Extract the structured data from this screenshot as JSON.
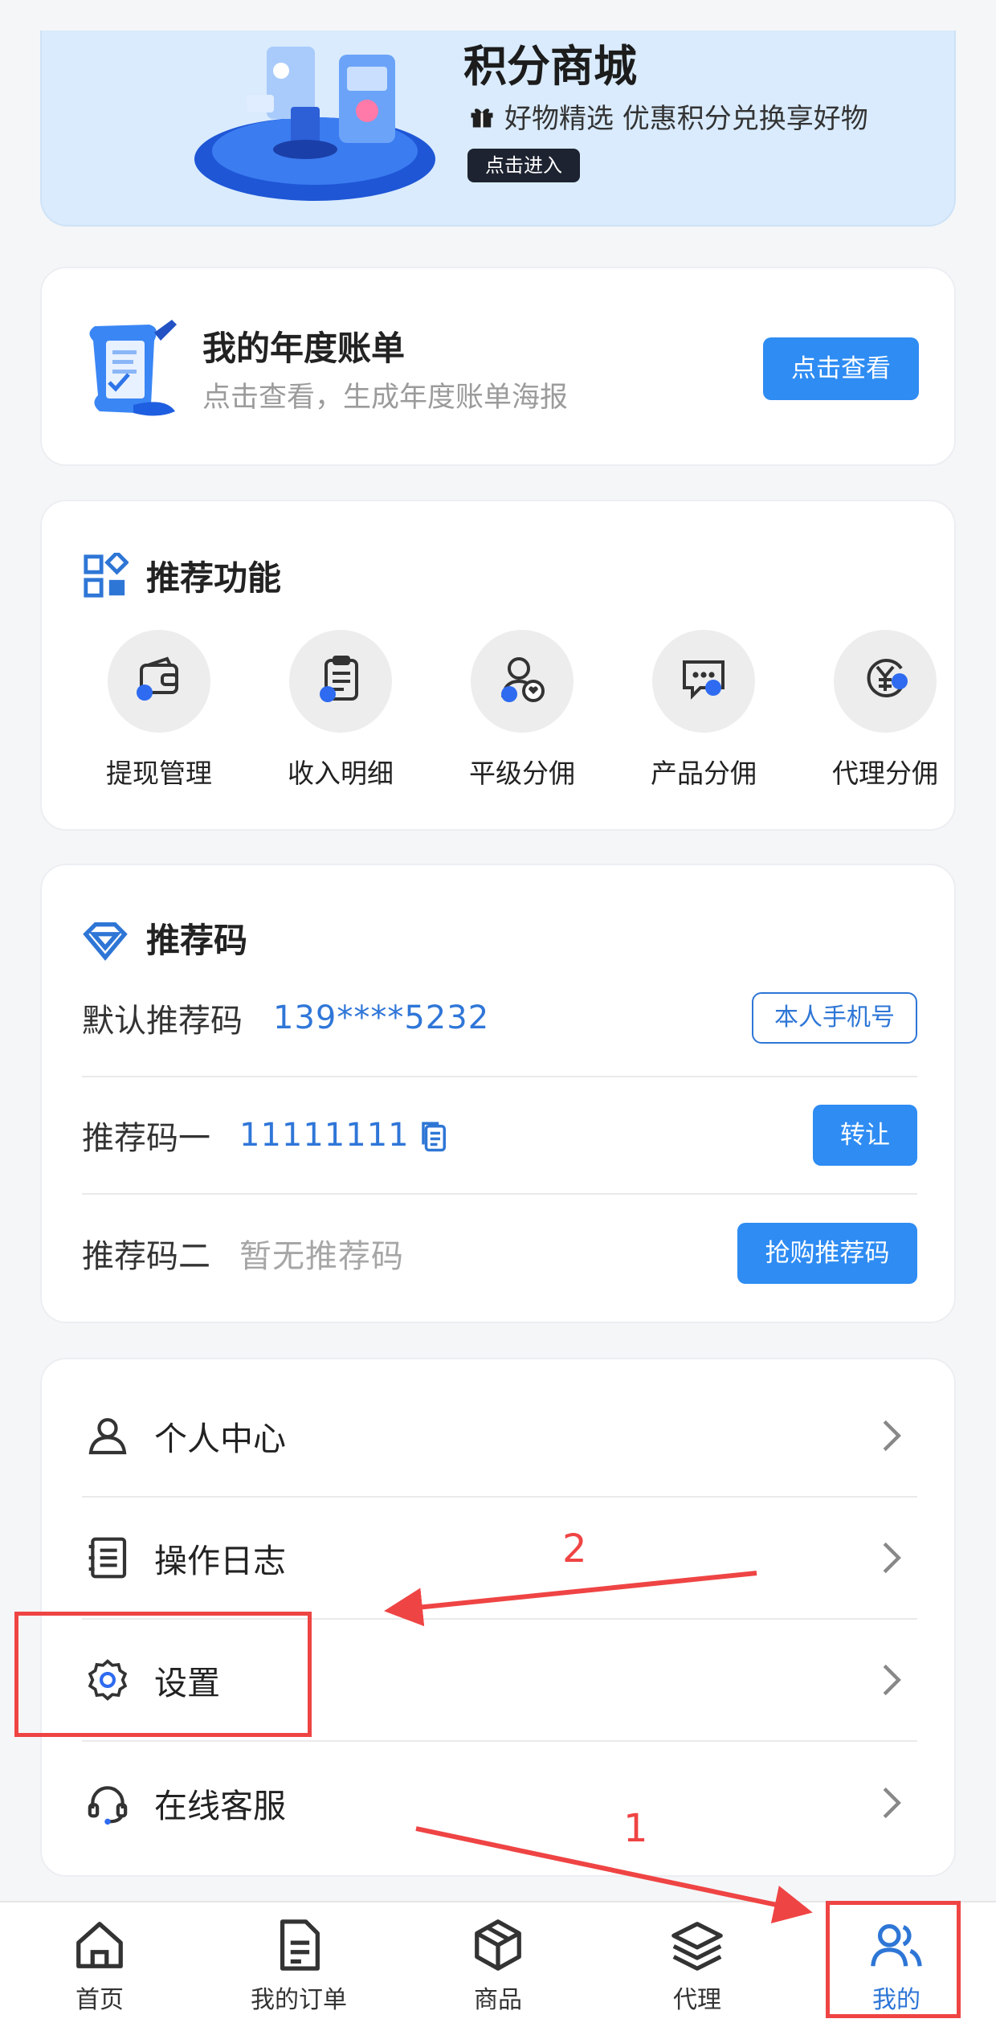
{
  "banner": {
    "title": "积分商城",
    "subtitle": "好物精选 优惠积分兑换享好物",
    "enter_label": "点击进入"
  },
  "bill": {
    "title": "我的年度账单",
    "subtitle": "点击查看，生成年度账单海报",
    "button_label": "点击查看"
  },
  "functions": {
    "title": "推荐功能",
    "items": [
      {
        "label": "提现管理",
        "icon": "wallet-icon"
      },
      {
        "label": "收入明细",
        "icon": "clipboard-icon"
      },
      {
        "label": "平级分佣",
        "icon": "user-heart-icon"
      },
      {
        "label": "产品分佣",
        "icon": "chat-icon"
      },
      {
        "label": "代理分佣",
        "icon": "yuan-icon"
      }
    ]
  },
  "codes": {
    "title": "推荐码",
    "rows": [
      {
        "label": "默认推荐码",
        "value": "139****5232",
        "action": "本人手机号"
      },
      {
        "label": "推荐码一",
        "value": "11111111",
        "action": "转让"
      },
      {
        "label": "推荐码二",
        "value": "暂无推荐码",
        "action": "抢购推荐码"
      }
    ]
  },
  "menu": {
    "items": [
      {
        "label": "个人中心",
        "icon": "user-icon"
      },
      {
        "label": "操作日志",
        "icon": "log-icon"
      },
      {
        "label": "设置",
        "icon": "gear-icon"
      },
      {
        "label": "在线客服",
        "icon": "headset-icon"
      }
    ]
  },
  "tabbar": {
    "items": [
      {
        "label": "首页",
        "icon": "home-icon"
      },
      {
        "label": "我的订单",
        "icon": "document-icon"
      },
      {
        "label": "商品",
        "icon": "box-icon"
      },
      {
        "label": "代理",
        "icon": "layers-icon"
      },
      {
        "label": "我的",
        "icon": "users-icon"
      }
    ],
    "active": "我的"
  },
  "annotations": {
    "step1": "1",
    "step2": "2"
  },
  "colors": {
    "accent": "#2e8cf3",
    "link": "#2f76d8",
    "annotation": "#ef4444"
  }
}
